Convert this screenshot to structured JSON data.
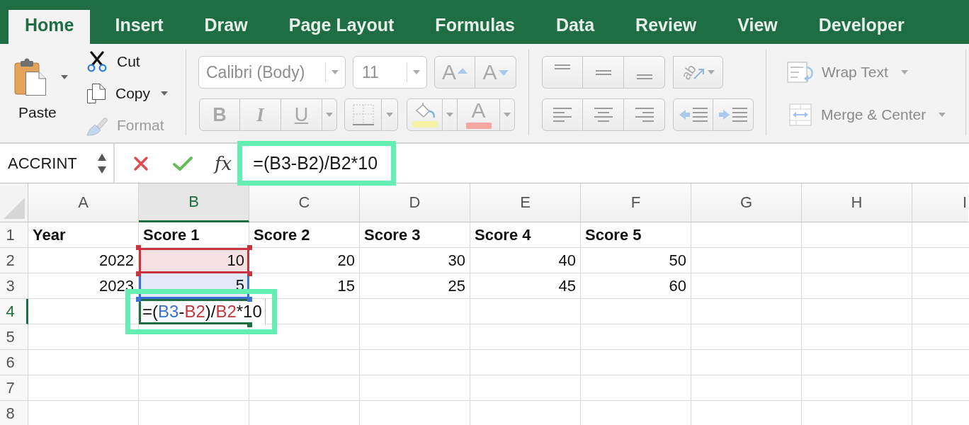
{
  "tabs": [
    {
      "label": "Home",
      "selected": true
    },
    {
      "label": "Insert",
      "selected": false
    },
    {
      "label": "Draw",
      "selected": false
    },
    {
      "label": "Page Layout",
      "selected": false
    },
    {
      "label": "Formulas",
      "selected": false
    },
    {
      "label": "Data",
      "selected": false
    },
    {
      "label": "Review",
      "selected": false
    },
    {
      "label": "View",
      "selected": false
    },
    {
      "label": "Developer",
      "selected": false
    }
  ],
  "clipboard": {
    "paste": {
      "label": "Paste",
      "disabled": false
    },
    "items": [
      {
        "kind": "cut",
        "label": "Cut",
        "disabled": false,
        "menu": false
      },
      {
        "kind": "copy",
        "label": "Copy",
        "disabled": false,
        "menu": true
      },
      {
        "kind": "format",
        "label": "Format",
        "disabled": true,
        "menu": false
      }
    ]
  },
  "font": {
    "disabled": true,
    "name": "Calibri (Body)",
    "size": "11",
    "size_buttons": [
      {
        "kind": "grow",
        "label": "A"
      },
      {
        "kind": "shrink",
        "label": "A"
      }
    ],
    "style_buttons": [
      {
        "kind": "bold",
        "label": "B",
        "menu": false
      },
      {
        "kind": "italic",
        "label": "I",
        "menu": false
      },
      {
        "kind": "underline",
        "label": "U",
        "menu": true
      }
    ],
    "color_buttons": [
      {
        "kind": "fill",
        "color": "#f4f2a3"
      },
      {
        "kind": "text",
        "label": "A",
        "color": "#f5a6a1"
      }
    ]
  },
  "alignment": {
    "disabled": true,
    "orientation": "ab",
    "wrap_text": "Wrap Text",
    "merge_center": "Merge & Center"
  },
  "formula_bar": {
    "name_box": "ACCRINT",
    "function_label": "fx",
    "formula": "=(B3-B2)/B2*10",
    "highlighted": true
  },
  "sheet": {
    "columns": [
      {
        "label": "A",
        "selected": false
      },
      {
        "label": "B",
        "selected": true
      },
      {
        "label": "C",
        "selected": false
      },
      {
        "label": "D",
        "selected": false
      },
      {
        "label": "E",
        "selected": false
      },
      {
        "label": "F",
        "selected": false
      },
      {
        "label": "G",
        "selected": false
      },
      {
        "label": "H",
        "selected": false
      },
      {
        "label": "I",
        "selected": false
      }
    ],
    "rows": [
      {
        "label": "1",
        "selected": false,
        "cells": [
          {
            "kind": "label",
            "text": "Year"
          },
          {
            "kind": "label",
            "text": "Score 1"
          },
          {
            "kind": "label",
            "text": "Score 2"
          },
          {
            "kind": "label",
            "text": "Score 3"
          },
          {
            "kind": "label",
            "text": "Score 4"
          },
          {
            "kind": "label",
            "text": "Score 5"
          }
        ]
      },
      {
        "label": "2",
        "selected": false,
        "cells": [
          {
            "kind": "number",
            "text": "2022"
          },
          {
            "kind": "number",
            "text": "10",
            "color": "#c7343f"
          },
          {
            "kind": "number",
            "text": "20"
          },
          {
            "kind": "number",
            "text": "30"
          },
          {
            "kind": "number",
            "text": "40"
          },
          {
            "kind": "number",
            "text": "50"
          }
        ]
      },
      {
        "label": "3",
        "selected": false,
        "cells": [
          {
            "kind": "number",
            "text": "2023"
          },
          {
            "kind": "number",
            "text": "5",
            "color": "#3b71d6"
          },
          {
            "kind": "number",
            "text": "15"
          },
          {
            "kind": "number",
            "text": "25"
          },
          {
            "kind": "number",
            "text": "45"
          },
          {
            "kind": "number",
            "text": "60"
          }
        ]
      },
      {
        "label": "4",
        "selected": true
      },
      {
        "label": "5",
        "selected": false
      },
      {
        "label": "6",
        "selected": false
      },
      {
        "label": "7",
        "selected": false
      },
      {
        "label": "8",
        "selected": false
      }
    ],
    "editor": {
      "tokens": [
        {
          "text": "=("
        },
        {
          "text": "B3",
          "color": "#3b71d6"
        },
        {
          "text": "-"
        },
        {
          "text": "B2",
          "color": "#c7343f"
        },
        {
          "text": ")/"
        },
        {
          "text": "B2",
          "color": "#c7343f"
        },
        {
          "text": "*10"
        }
      ],
      "highlighted": true
    }
  }
}
